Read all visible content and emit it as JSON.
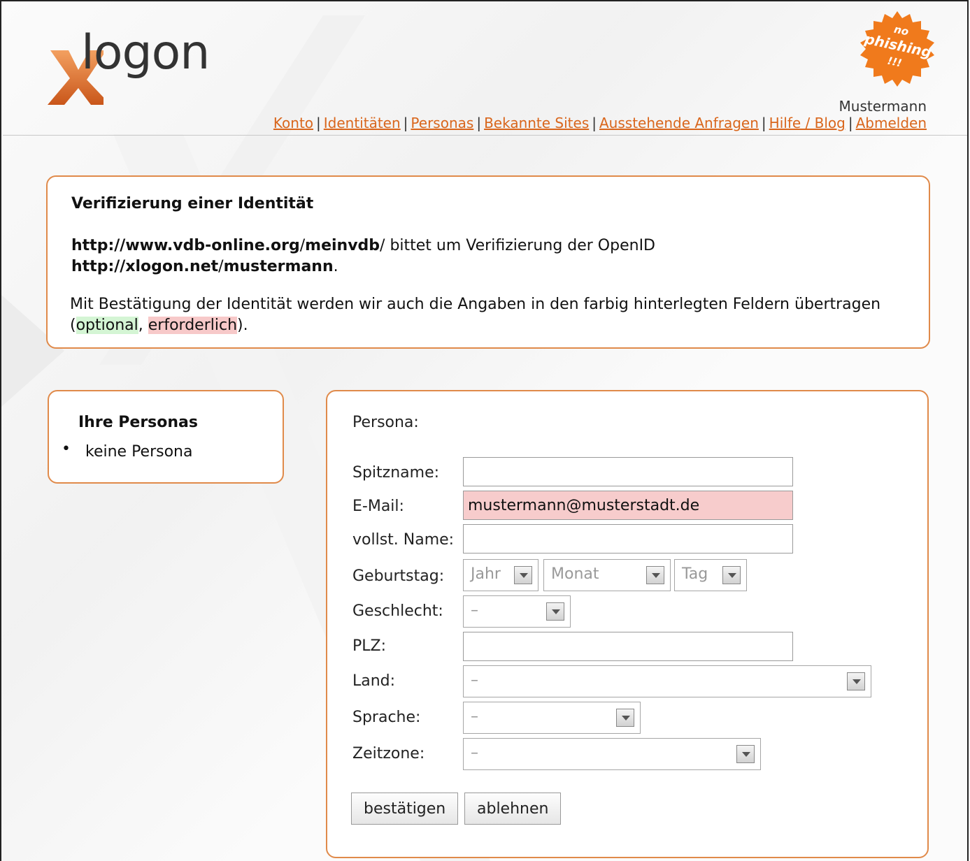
{
  "header": {
    "logo_text": "logon",
    "logo_letter": "x",
    "badge": {
      "line1": "no",
      "line2": "phishing",
      "line3": "!!!"
    },
    "username": "Mustermann",
    "nav": [
      {
        "label": "Konto"
      },
      {
        "label": "Identitäten"
      },
      {
        "label": "Personas"
      },
      {
        "label": "Bekannte Sites"
      },
      {
        "label": "Ausstehende Anfragen"
      },
      {
        "label": "Hilfe / Blog"
      },
      {
        "label": "Abmelden"
      }
    ],
    "separator": "|"
  },
  "verify": {
    "title": "Verifizierung einer Identität",
    "site_url": "http://www.vdb-online.org/meinvdb/",
    "site_url_parts": {
      "a": "http://",
      "b": "www.vdb-online.org",
      "c": "/",
      "d": "meinvdb",
      "e": "/"
    },
    "request_text": " bittet um Verifizierung der OpenID",
    "openid_parts": {
      "a": "http://",
      "b": "xlogon.net",
      "c": "/",
      "d": "mustermann"
    },
    "period": ".",
    "info_text": "Mit Bestätigung der Identität werden wir auch die Angaben in den farbig hinterlegten Feldern übertragen (",
    "optional": "optional",
    "comma": ", ",
    "required": "erforderlich",
    "close": ")."
  },
  "personas": {
    "title": "Ihre Personas",
    "items": [
      "keine Persona"
    ]
  },
  "form": {
    "persona_label": "Persona:",
    "fields": {
      "nickname": {
        "label": "Spitzname:",
        "value": ""
      },
      "email": {
        "label": "E-Mail:",
        "value": "mustermann@musterstadt.de"
      },
      "fullname": {
        "label": "vollst. Name:",
        "value": ""
      },
      "birthday": {
        "label": "Geburtstag:",
        "year": "Jahr",
        "month": "Monat",
        "day": "Tag"
      },
      "gender": {
        "label": "Geschlecht:",
        "value": "–"
      },
      "zip": {
        "label": "PLZ:",
        "value": ""
      },
      "country": {
        "label": "Land:",
        "value": "–"
      },
      "language": {
        "label": "Sprache:",
        "value": "–"
      },
      "timezone": {
        "label": "Zeitzone:",
        "value": "–"
      }
    },
    "confirm_label": "bestätigen",
    "reject_label": "ablehnen"
  },
  "colors": {
    "accent": "#d9661c",
    "panel_border": "#e08a4a",
    "optional_bg": "#d4f5d4",
    "required_bg": "#f7c9c9"
  }
}
